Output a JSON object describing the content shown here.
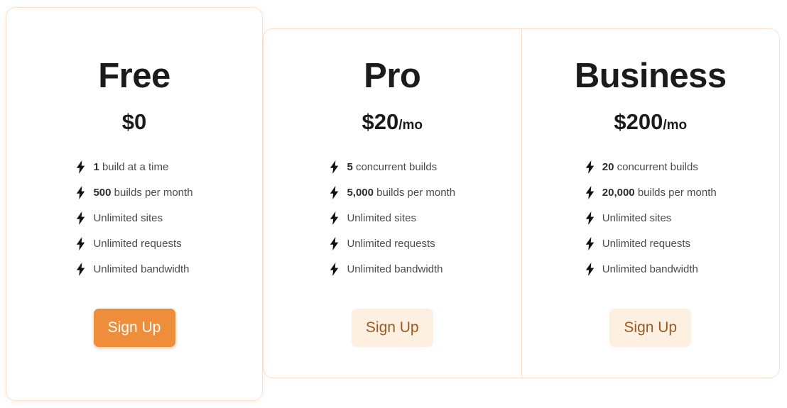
{
  "theme": {
    "accent": "#ee8e3b",
    "accent_soft": "#fdf0e0",
    "accent_text": "#9c5a22",
    "border": "#fae0c8",
    "heading_color": "#1b1b1b",
    "feature_color": "#4b4b4b"
  },
  "icons": {
    "feature_bullet": "lightning-bolt-icon"
  },
  "plans": [
    {
      "id": "free",
      "name": "Free",
      "price": "$0",
      "period": "",
      "features": [
        {
          "lead": "1",
          "rest": " build at a time"
        },
        {
          "lead": "500",
          "rest": " builds per month"
        },
        {
          "lead": "",
          "rest": "Unlimited sites"
        },
        {
          "lead": "",
          "rest": "Unlimited requests"
        },
        {
          "lead": "",
          "rest": "Unlimited bandwidth"
        }
      ],
      "cta": "Sign Up",
      "cta_style": "primary"
    },
    {
      "id": "pro",
      "name": "Pro",
      "price": "$20",
      "period": "/mo",
      "features": [
        {
          "lead": "5",
          "rest": " concurrent builds"
        },
        {
          "lead": "5,000",
          "rest": " builds per month"
        },
        {
          "lead": "",
          "rest": "Unlimited sites"
        },
        {
          "lead": "",
          "rest": "Unlimited requests"
        },
        {
          "lead": "",
          "rest": "Unlimited bandwidth"
        }
      ],
      "cta": "Sign Up",
      "cta_style": "secondary"
    },
    {
      "id": "business",
      "name": "Business",
      "price": "$200",
      "period": "/mo",
      "features": [
        {
          "lead": "20",
          "rest": " concurrent builds"
        },
        {
          "lead": "20,000",
          "rest": " builds per month"
        },
        {
          "lead": "",
          "rest": "Unlimited sites"
        },
        {
          "lead": "",
          "rest": "Unlimited requests"
        },
        {
          "lead": "",
          "rest": "Unlimited bandwidth"
        }
      ],
      "cta": "Sign Up",
      "cta_style": "secondary"
    }
  ]
}
